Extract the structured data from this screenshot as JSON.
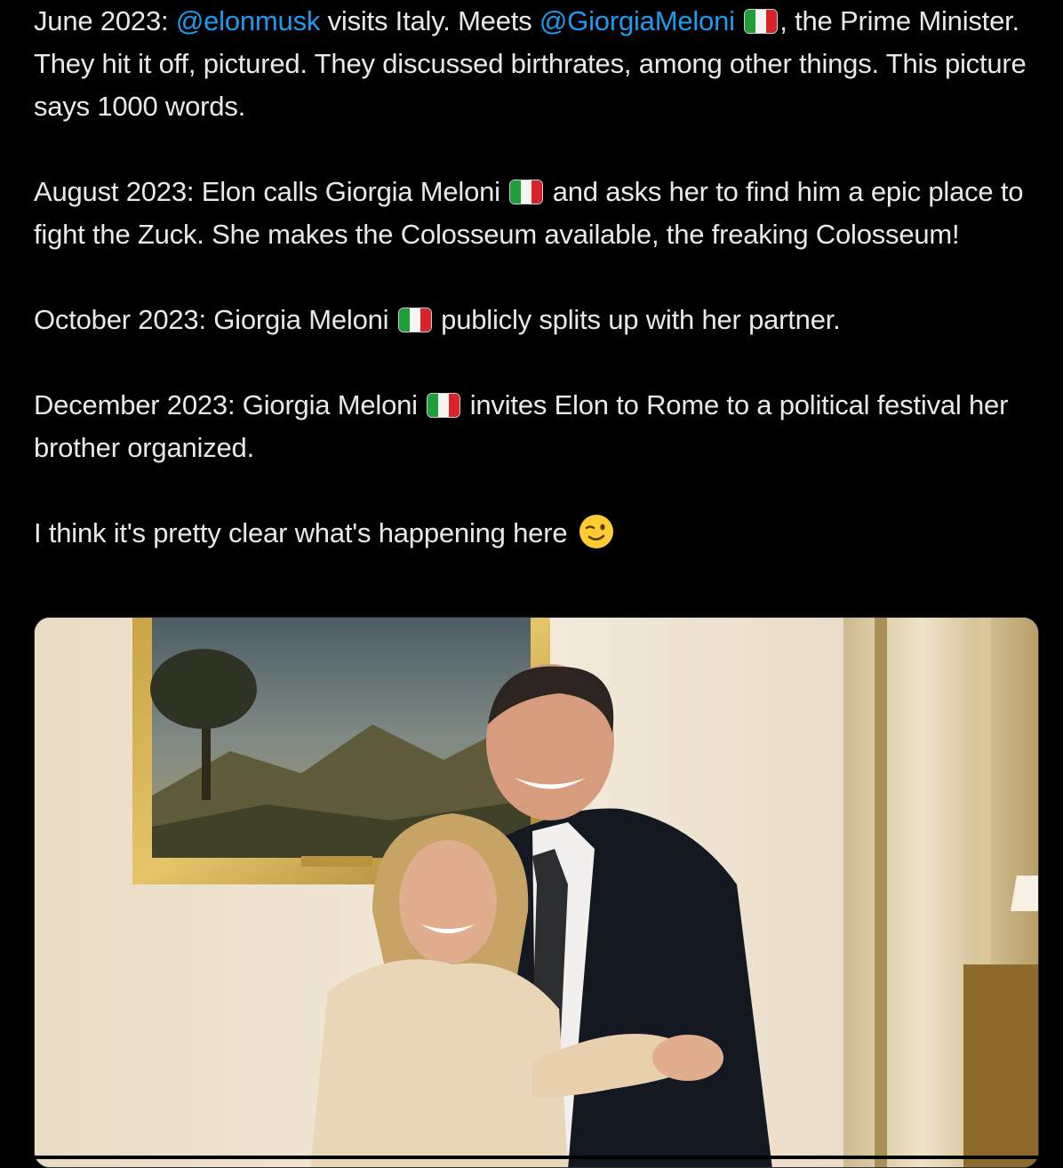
{
  "tweet": {
    "paragraphs": [
      {
        "segments": [
          {
            "type": "text",
            "text": "June 2023: "
          },
          {
            "type": "mention",
            "text": "@elonmusk"
          },
          {
            "type": "text",
            "text": " visits Italy. Meets "
          },
          {
            "type": "mention",
            "text": "@GiorgiaMeloni"
          },
          {
            "type": "text",
            "text": " "
          },
          {
            "type": "flag",
            "icon": "italy-flag-icon"
          },
          {
            "type": "text",
            "text": ", the Prime Minister. They hit it off, pictured. They discussed birthrates, among other things. This picture says 1000 words."
          }
        ]
      },
      {
        "segments": [
          {
            "type": "text",
            "text": "August 2023: Elon calls Giorgia Meloni "
          },
          {
            "type": "flag",
            "icon": "italy-flag-icon"
          },
          {
            "type": "text",
            "text": " and asks her to find him a epic place to fight the Zuck. She makes the Colosseum available, the freaking Colosseum!"
          }
        ]
      },
      {
        "segments": [
          {
            "type": "text",
            "text": "October 2023: Giorgia Meloni "
          },
          {
            "type": "flag",
            "icon": "italy-flag-icon"
          },
          {
            "type": "text",
            "text": " publicly splits up with her partner."
          }
        ]
      },
      {
        "segments": [
          {
            "type": "text",
            "text": "December 2023: Giorgia Meloni "
          },
          {
            "type": "flag",
            "icon": "italy-flag-icon"
          },
          {
            "type": "text",
            "text": " invites Elon to Rome to a political festival her brother organized."
          }
        ]
      },
      {
        "segments": [
          {
            "type": "text",
            "text": "I think it's pretty clear what's happening here "
          },
          {
            "type": "emoji",
            "icon": "winking-face-icon"
          }
        ]
      }
    ]
  },
  "colors": {
    "background": "#000000",
    "text": "#e7e9ea",
    "mention": "#1d9bf0",
    "flag_green": "#1f9e3a",
    "flag_white": "#f4f4f4",
    "flag_red": "#d8232a",
    "emoji_yellow": "#ffcc33"
  },
  "media": {
    "icon": "photo-attachment-icon"
  }
}
